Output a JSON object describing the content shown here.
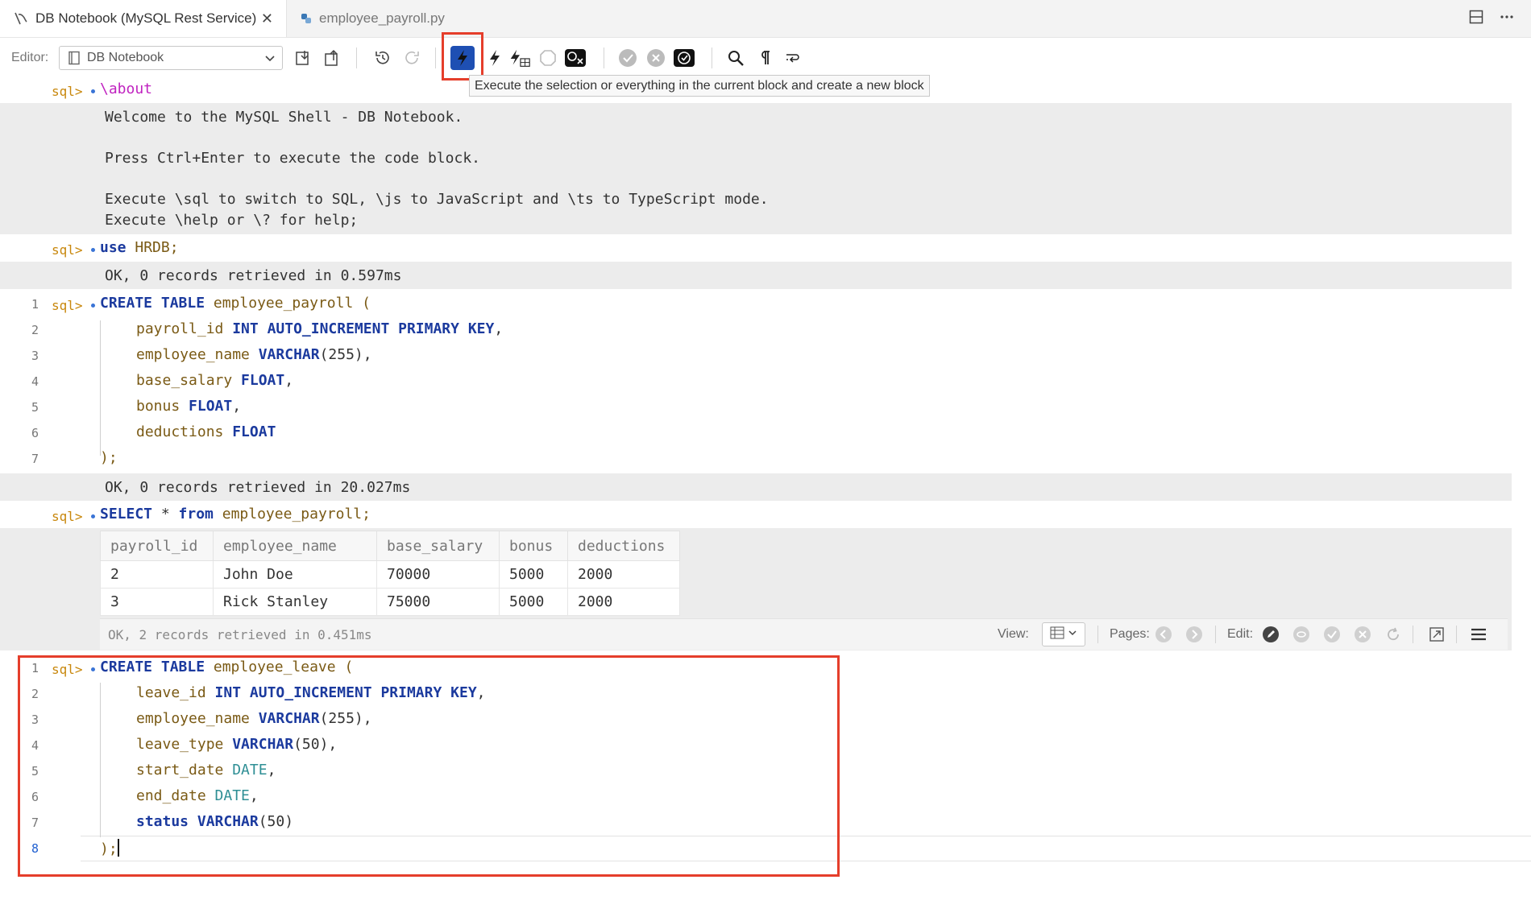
{
  "tabs": [
    {
      "label": "DB Notebook (MySQL Rest Service)",
      "icon": "db-notebook-icon",
      "active": true,
      "close": "✕"
    },
    {
      "label": "employee_payroll.py",
      "icon": "python-file-icon",
      "active": false
    }
  ],
  "toolbar": {
    "editor_label": "Editor:",
    "editor_value": "DB Notebook",
    "tooltip": "Execute the selection or everything in the current block and create a new block"
  },
  "blocks": {
    "about": {
      "prompt": "sql>",
      "command": "\\about",
      "output": [
        "Welcome to the MySQL Shell - DB Notebook.",
        "Press Ctrl+Enter to execute the code block.",
        "Execute \\sql to switch to SQL, \\js to JavaScript and \\ts to TypeScript mode.",
        "Execute \\help or \\? for help;"
      ]
    },
    "use": {
      "prompt": "sql>",
      "kw": "use",
      "rest": " HRDB;",
      "output": "OK, 0 records retrieved in 0.597ms"
    },
    "create_payroll": {
      "prompt": "sql>",
      "lines": [
        {
          "num": "1",
          "parts": [
            "CREATE TABLE",
            " employee_payroll ("
          ]
        },
        {
          "num": "2",
          "parts": [
            "payroll_id ",
            "INT AUTO_INCREMENT PRIMARY KEY",
            ","
          ]
        },
        {
          "num": "3",
          "parts": [
            "employee_name ",
            "VARCHAR",
            "(255),"
          ]
        },
        {
          "num": "4",
          "parts": [
            "base_salary ",
            "FLOAT",
            ","
          ]
        },
        {
          "num": "5",
          "parts": [
            "bonus ",
            "FLOAT",
            ","
          ]
        },
        {
          "num": "6",
          "parts": [
            "deductions ",
            "FLOAT",
            ""
          ]
        },
        {
          "num": "7",
          "parts": [
            ");"
          ]
        }
      ],
      "output": "OK, 0 records retrieved in 20.027ms"
    },
    "select": {
      "prompt": "sql>",
      "kw1": "SELECT",
      "star": " * ",
      "kw2": "from",
      "rest": " employee_payroll;",
      "columns": [
        "payroll_id",
        "employee_name",
        "base_salary",
        "bonus",
        "deductions"
      ],
      "rows": [
        [
          "2",
          "John Doe",
          "70000",
          "5000",
          "2000"
        ],
        [
          "3",
          "Rick Stanley",
          "75000",
          "5000",
          "2000"
        ]
      ],
      "status": "OK, 2 records retrieved in 0.451ms",
      "view_label": "View:",
      "pages_label": "Pages:",
      "edit_label": "Edit:"
    },
    "create_leave": {
      "prompt": "sql>",
      "lines": [
        {
          "num": "1",
          "parts": [
            "CREATE TABLE",
            " employee_leave ("
          ]
        },
        {
          "num": "2",
          "parts": [
            "leave_id ",
            "INT AUTO_INCREMENT PRIMARY KEY",
            ","
          ]
        },
        {
          "num": "3",
          "parts": [
            "employee_name ",
            "VARCHAR",
            "(255),"
          ]
        },
        {
          "num": "4",
          "parts": [
            "leave_type ",
            "VARCHAR",
            "(50),"
          ]
        },
        {
          "num": "5",
          "parts": [
            "start_date ",
            "DATE",
            ","
          ]
        },
        {
          "num": "6",
          "parts": [
            "end_date ",
            "DATE",
            ","
          ]
        },
        {
          "num": "7",
          "parts": [
            "status ",
            "VARCHAR",
            "(50)"
          ]
        },
        {
          "num": "8",
          "parts": [
            ");"
          ]
        }
      ]
    }
  },
  "colors": {
    "accent": "#1e4fb3",
    "highlight": "#e53e2b",
    "prompt": "#c8870c",
    "keyword": "#1b3a9e",
    "type": "#2f8f95"
  }
}
